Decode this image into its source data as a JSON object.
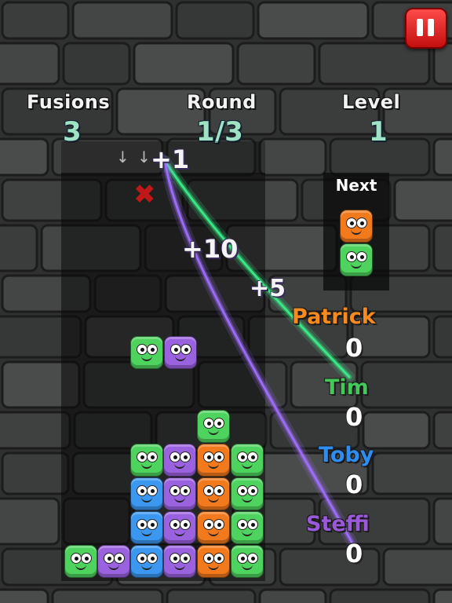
{
  "hud": {
    "fusions_label": "Fusions",
    "fusions_value": "3",
    "round_label": "Round",
    "round_value": "1/3",
    "level_label": "Level",
    "level_value": "1"
  },
  "next": {
    "label": "Next",
    "blocks": [
      "orange",
      "green"
    ]
  },
  "drop_hint": "↓ ↓",
  "floating_points": [
    "+1",
    "+10",
    "+5"
  ],
  "players": [
    {
      "name": "Patrick",
      "score": "0",
      "color": "#f68a1e"
    },
    {
      "name": "Tim",
      "score": "0",
      "color": "#43c85a"
    },
    {
      "name": "Toby",
      "score": "0",
      "color": "#2e8df0"
    },
    {
      "name": "Steffi",
      "score": "0",
      "color": "#9a5ad8"
    }
  ],
  "colors": {
    "green": "#4fd35f",
    "purple": "#9b62e0",
    "blue": "#3b97ef",
    "orange": "#f27a1c",
    "pause": "#e02020",
    "trail_green": "#3cf08a",
    "trail_purple": "#a070ff"
  },
  "falling_pair": [
    "green",
    "purple"
  ],
  "stack_columns": [
    [
      "green"
    ],
    [
      "purple"
    ],
    [
      "blue",
      "blue",
      "blue",
      "green"
    ],
    [
      "purple",
      "purple",
      "purple",
      "purple"
    ],
    [
      "orange",
      "orange",
      "orange",
      "orange",
      "green"
    ],
    [
      "green",
      "green",
      "green",
      "green"
    ]
  ]
}
